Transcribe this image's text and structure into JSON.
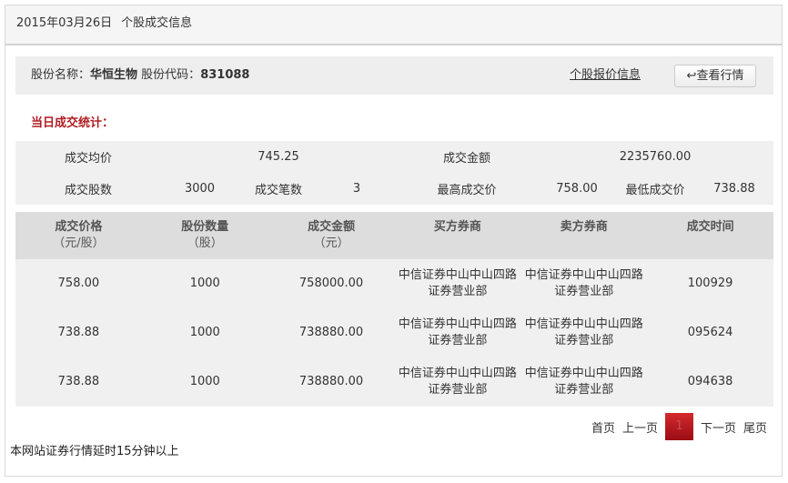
{
  "header": {
    "date": "2015年03月26日",
    "title": "个股成交信息"
  },
  "info": {
    "name_label": "股份名称：",
    "name": "华恒生物",
    "code_label": "股份代码：",
    "code": "831088",
    "quote_link": "个股报价信息",
    "view_button": "查看行情",
    "view_icon": "return-arrow-icon"
  },
  "stats": {
    "title": "当日成交统计：",
    "avg_price_label": "成交均价",
    "avg_price": "745.25",
    "amount_label": "成交金额",
    "amount": "2235760.00",
    "volume_label": "成交股数",
    "volume": "3000",
    "count_label": "成交笔数",
    "count": "3",
    "high_label": "最高成交价",
    "high": "758.00",
    "low_label": "最低成交价",
    "low": "738.88"
  },
  "table": {
    "headers": [
      {
        "t": "成交价格",
        "u": "（元/股）"
      },
      {
        "t": "股份数量",
        "u": "（股）"
      },
      {
        "t": "成交金额",
        "u": "（元）"
      },
      {
        "t": "买方券商",
        "u": ""
      },
      {
        "t": "卖方券商",
        "u": ""
      },
      {
        "t": "成交时间",
        "u": ""
      }
    ],
    "rows": [
      [
        "758.00",
        "1000",
        "758000.00",
        "中信证券中山中山四路证券营业部",
        "中信证券中山中山四路证券营业部",
        "100929"
      ],
      [
        "738.88",
        "1000",
        "738880.00",
        "中信证券中山中山四路证券营业部",
        "中信证券中山中山四路证券营业部",
        "095624"
      ],
      [
        "738.88",
        "1000",
        "738880.00",
        "中信证券中山中山四路证券营业部",
        "中信证券中山中山四路证券营业部",
        "094638"
      ]
    ]
  },
  "pager": {
    "first": "首页",
    "prev": "上一页",
    "current": "1",
    "next": "下一页",
    "last": "尾页"
  },
  "footer": "本网站证券行情延时15分钟以上",
  "colors": {
    "accent": "#b01c22"
  }
}
